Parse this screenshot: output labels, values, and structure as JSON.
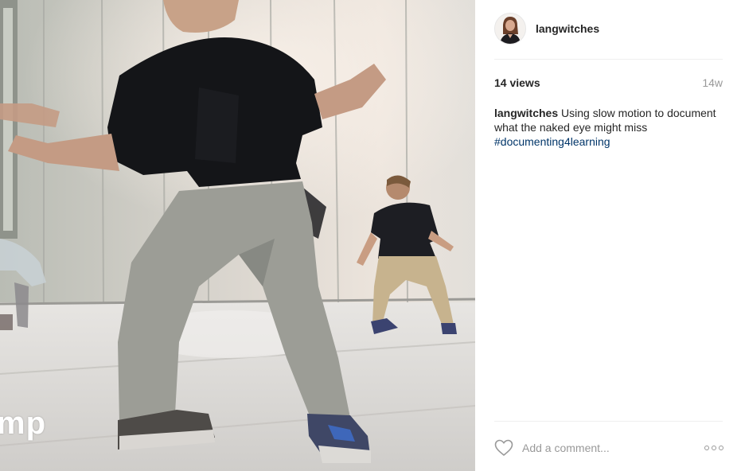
{
  "post": {
    "username": "langwitches",
    "views": "14 views",
    "age": "14w",
    "caption_user": "langwitches",
    "caption_text": "Using slow motion to document what the naked eye might miss",
    "hashtag": "#documenting4learning",
    "video_overlay_text": "mp"
  },
  "comment": {
    "placeholder": "Add a comment..."
  },
  "icons": {
    "like": "heart-icon",
    "options": "more-options-icon",
    "avatar": "profile-avatar"
  },
  "colors": {
    "hashtag": "#003569",
    "muted": "#999999",
    "text": "#262626"
  }
}
